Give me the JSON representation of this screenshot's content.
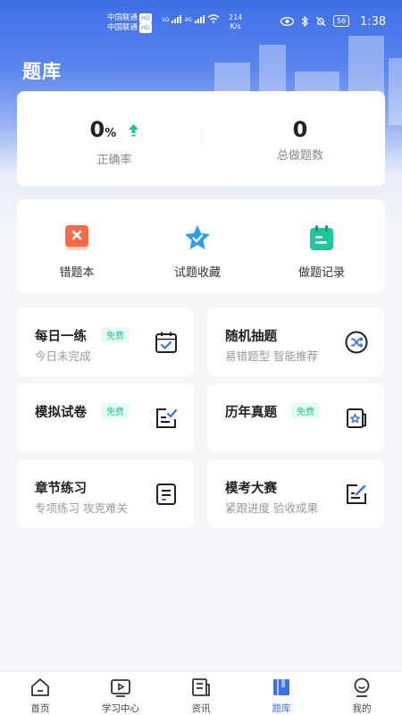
{
  "status_bar": {
    "carrier1": "中国联通",
    "carrier2": "中国联通",
    "hd": "HD",
    "network1": "5G",
    "network2": "4G",
    "speed_value": "214",
    "speed_unit": "K/s",
    "battery": "56",
    "time": "1:38"
  },
  "page": {
    "title": "题库"
  },
  "stats": [
    {
      "value": "0",
      "unit": "%",
      "label": "正确率",
      "trend_icon": "arrow-up-icon",
      "trend_color": "#1ec298"
    },
    {
      "value": "0",
      "unit": "",
      "label": "总做题数"
    }
  ],
  "tools": [
    {
      "label": "错题本",
      "icon": "wrong-book-icon",
      "color": "#f36b4a"
    },
    {
      "label": "试题收藏",
      "icon": "star-icon",
      "color": "#2d9cf4"
    },
    {
      "label": "做题记录",
      "icon": "calendar-record-icon",
      "color": "#22c59a"
    }
  ],
  "tiles": [
    {
      "title": "每日一练",
      "badge": "免费",
      "subtitle": "今日未完成",
      "icon": "calendar-check-icon"
    },
    {
      "title": "随机抽题",
      "badge": "",
      "subtitle": "易错题型 智能推荐",
      "icon": "shuffle-icon"
    },
    {
      "title": "模拟试卷",
      "badge": "免费",
      "subtitle": "",
      "icon": "exam-paper-icon"
    },
    {
      "title": "历年真题",
      "badge": "免费",
      "subtitle": "",
      "icon": "past-papers-icon"
    },
    {
      "title": "章节练习",
      "badge": "",
      "subtitle": "专项练习 攻克难关",
      "icon": "notebook-icon"
    },
    {
      "title": "模考大赛",
      "badge": "",
      "subtitle": "紧跟进度 验收成果",
      "icon": "edit-icon"
    }
  ],
  "tabbar": [
    {
      "label": "首页",
      "icon": "home-icon",
      "active": false
    },
    {
      "label": "学习中心",
      "icon": "video-icon",
      "active": false
    },
    {
      "label": "资讯",
      "icon": "news-icon",
      "active": false
    },
    {
      "label": "题库",
      "icon": "question-bank-icon",
      "active": true
    },
    {
      "label": "我的",
      "icon": "profile-icon",
      "active": false
    }
  ],
  "colors": {
    "accent": "#3b6fe3",
    "badge_text": "#1ec298",
    "badge_bg": "#e8faf4",
    "header_gradient_top": "#3f6ee6"
  }
}
